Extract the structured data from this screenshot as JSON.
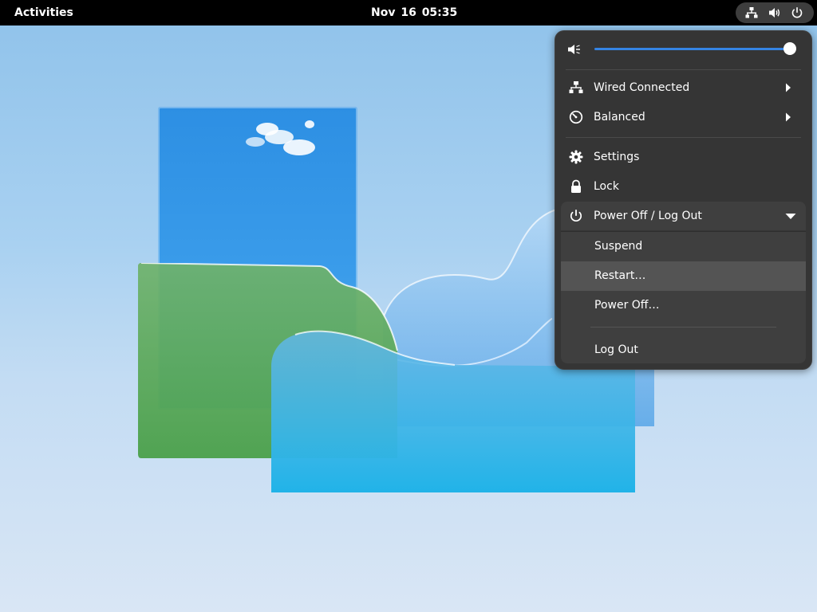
{
  "topbar": {
    "activities_label": "Activities",
    "clock": "Nov 16  05:35",
    "indicators": [
      "network-wired-icon",
      "speaker-volume-icon",
      "power-icon"
    ]
  },
  "quick_settings": {
    "volume": {
      "icon": "speaker-muted-icon",
      "level": 1.0
    },
    "network": {
      "icon": "network-wired-icon",
      "label": "Wired Connected",
      "arrow": "chevron-right-icon"
    },
    "power_mode": {
      "icon": "power-profile-icon",
      "label": "Balanced",
      "arrow": "chevron-right-icon"
    },
    "settings": {
      "icon": "gear-icon",
      "label": "Settings"
    },
    "lock": {
      "icon": "lock-icon",
      "label": "Lock"
    },
    "power_menu": {
      "icon": "power-icon",
      "label": "Power Off / Log Out",
      "arrow": "chevron-down-icon",
      "expanded": true,
      "items": [
        {
          "label": "Suspend"
        },
        {
          "label": "Restart…"
        },
        {
          "label": "Power Off…"
        },
        {
          "label": "Log Out"
        }
      ],
      "hovered_item": "Restart…"
    }
  },
  "colors": {
    "topbar_bg": "#000000",
    "menu_bg": "#353535",
    "submenu_bg": "#3f3f3f",
    "hover_bg": "#545454",
    "accent": "#3584e4"
  }
}
